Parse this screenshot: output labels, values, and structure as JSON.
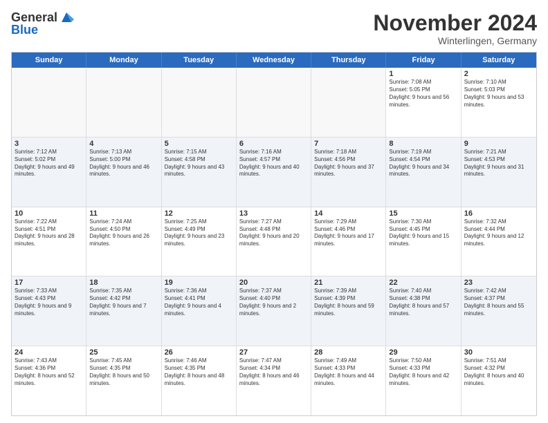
{
  "logo": {
    "general": "General",
    "blue": "Blue"
  },
  "title": "November 2024",
  "location": "Winterlingen, Germany",
  "days_of_week": [
    "Sunday",
    "Monday",
    "Tuesday",
    "Wednesday",
    "Thursday",
    "Friday",
    "Saturday"
  ],
  "rows": [
    [
      {
        "day": "",
        "empty": true
      },
      {
        "day": "",
        "empty": true
      },
      {
        "day": "",
        "empty": true
      },
      {
        "day": "",
        "empty": true
      },
      {
        "day": "",
        "empty": true
      },
      {
        "day": "1",
        "sunrise": "Sunrise: 7:08 AM",
        "sunset": "Sunset: 5:05 PM",
        "daylight": "Daylight: 9 hours and 56 minutes."
      },
      {
        "day": "2",
        "sunrise": "Sunrise: 7:10 AM",
        "sunset": "Sunset: 5:03 PM",
        "daylight": "Daylight: 9 hours and 53 minutes."
      }
    ],
    [
      {
        "day": "3",
        "sunrise": "Sunrise: 7:12 AM",
        "sunset": "Sunset: 5:02 PM",
        "daylight": "Daylight: 9 hours and 49 minutes."
      },
      {
        "day": "4",
        "sunrise": "Sunrise: 7:13 AM",
        "sunset": "Sunset: 5:00 PM",
        "daylight": "Daylight: 9 hours and 46 minutes."
      },
      {
        "day": "5",
        "sunrise": "Sunrise: 7:15 AM",
        "sunset": "Sunset: 4:58 PM",
        "daylight": "Daylight: 9 hours and 43 minutes."
      },
      {
        "day": "6",
        "sunrise": "Sunrise: 7:16 AM",
        "sunset": "Sunset: 4:57 PM",
        "daylight": "Daylight: 9 hours and 40 minutes."
      },
      {
        "day": "7",
        "sunrise": "Sunrise: 7:18 AM",
        "sunset": "Sunset: 4:56 PM",
        "daylight": "Daylight: 9 hours and 37 minutes."
      },
      {
        "day": "8",
        "sunrise": "Sunrise: 7:19 AM",
        "sunset": "Sunset: 4:54 PM",
        "daylight": "Daylight: 9 hours and 34 minutes."
      },
      {
        "day": "9",
        "sunrise": "Sunrise: 7:21 AM",
        "sunset": "Sunset: 4:53 PM",
        "daylight": "Daylight: 9 hours and 31 minutes."
      }
    ],
    [
      {
        "day": "10",
        "sunrise": "Sunrise: 7:22 AM",
        "sunset": "Sunset: 4:51 PM",
        "daylight": "Daylight: 9 hours and 28 minutes."
      },
      {
        "day": "11",
        "sunrise": "Sunrise: 7:24 AM",
        "sunset": "Sunset: 4:50 PM",
        "daylight": "Daylight: 9 hours and 26 minutes."
      },
      {
        "day": "12",
        "sunrise": "Sunrise: 7:25 AM",
        "sunset": "Sunset: 4:49 PM",
        "daylight": "Daylight: 9 hours and 23 minutes."
      },
      {
        "day": "13",
        "sunrise": "Sunrise: 7:27 AM",
        "sunset": "Sunset: 4:48 PM",
        "daylight": "Daylight: 9 hours and 20 minutes."
      },
      {
        "day": "14",
        "sunrise": "Sunrise: 7:29 AM",
        "sunset": "Sunset: 4:46 PM",
        "daylight": "Daylight: 9 hours and 17 minutes."
      },
      {
        "day": "15",
        "sunrise": "Sunrise: 7:30 AM",
        "sunset": "Sunset: 4:45 PM",
        "daylight": "Daylight: 9 hours and 15 minutes."
      },
      {
        "day": "16",
        "sunrise": "Sunrise: 7:32 AM",
        "sunset": "Sunset: 4:44 PM",
        "daylight": "Daylight: 9 hours and 12 minutes."
      }
    ],
    [
      {
        "day": "17",
        "sunrise": "Sunrise: 7:33 AM",
        "sunset": "Sunset: 4:43 PM",
        "daylight": "Daylight: 9 hours and 9 minutes."
      },
      {
        "day": "18",
        "sunrise": "Sunrise: 7:35 AM",
        "sunset": "Sunset: 4:42 PM",
        "daylight": "Daylight: 9 hours and 7 minutes."
      },
      {
        "day": "19",
        "sunrise": "Sunrise: 7:36 AM",
        "sunset": "Sunset: 4:41 PM",
        "daylight": "Daylight: 9 hours and 4 minutes."
      },
      {
        "day": "20",
        "sunrise": "Sunrise: 7:37 AM",
        "sunset": "Sunset: 4:40 PM",
        "daylight": "Daylight: 9 hours and 2 minutes."
      },
      {
        "day": "21",
        "sunrise": "Sunrise: 7:39 AM",
        "sunset": "Sunset: 4:39 PM",
        "daylight": "Daylight: 8 hours and 59 minutes."
      },
      {
        "day": "22",
        "sunrise": "Sunrise: 7:40 AM",
        "sunset": "Sunset: 4:38 PM",
        "daylight": "Daylight: 8 hours and 57 minutes."
      },
      {
        "day": "23",
        "sunrise": "Sunrise: 7:42 AM",
        "sunset": "Sunset: 4:37 PM",
        "daylight": "Daylight: 8 hours and 55 minutes."
      }
    ],
    [
      {
        "day": "24",
        "sunrise": "Sunrise: 7:43 AM",
        "sunset": "Sunset: 4:36 PM",
        "daylight": "Daylight: 8 hours and 52 minutes."
      },
      {
        "day": "25",
        "sunrise": "Sunrise: 7:45 AM",
        "sunset": "Sunset: 4:35 PM",
        "daylight": "Daylight: 8 hours and 50 minutes."
      },
      {
        "day": "26",
        "sunrise": "Sunrise: 7:46 AM",
        "sunset": "Sunset: 4:35 PM",
        "daylight": "Daylight: 8 hours and 48 minutes."
      },
      {
        "day": "27",
        "sunrise": "Sunrise: 7:47 AM",
        "sunset": "Sunset: 4:34 PM",
        "daylight": "Daylight: 8 hours and 46 minutes."
      },
      {
        "day": "28",
        "sunrise": "Sunrise: 7:49 AM",
        "sunset": "Sunset: 4:33 PM",
        "daylight": "Daylight: 8 hours and 44 minutes."
      },
      {
        "day": "29",
        "sunrise": "Sunrise: 7:50 AM",
        "sunset": "Sunset: 4:33 PM",
        "daylight": "Daylight: 8 hours and 42 minutes."
      },
      {
        "day": "30",
        "sunrise": "Sunrise: 7:51 AM",
        "sunset": "Sunset: 4:32 PM",
        "daylight": "Daylight: 8 hours and 40 minutes."
      }
    ]
  ]
}
